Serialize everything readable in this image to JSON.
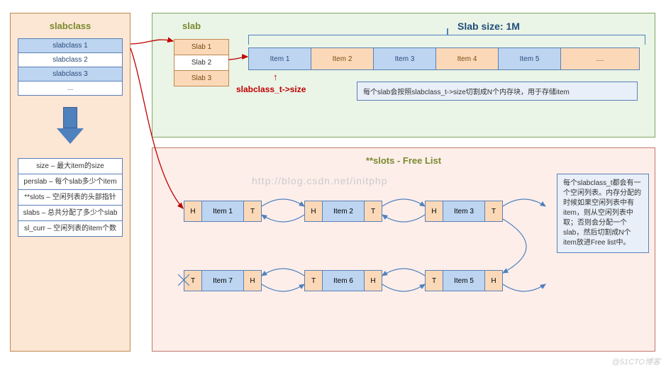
{
  "left": {
    "title": "slabclass",
    "classes": [
      "slabclass 1",
      "slabclass 2",
      "slabclass 3",
      "..."
    ],
    "fields": [
      "size – 最大item的size",
      "perslab – 每个slab多少个item",
      "**slots – 空闲列表的头部指针",
      "slabs – 总共分配了多少个slab",
      "sl_curr – 空闲列表的item个数"
    ]
  },
  "top": {
    "title": "slab",
    "size_title": "Slab size: 1M",
    "slabs": [
      "Slab 1",
      "Slab 2",
      "Slab 3"
    ],
    "items": [
      "Item 1",
      "Item 2",
      "Item 3",
      "Item 4",
      "Item 5",
      "...."
    ],
    "red_ptr": "↑",
    "red_label": "slabclass_t->size",
    "note": "每个slab会按照slabclass_t->size切割成N个内存块，用于存储item"
  },
  "bot": {
    "title": "**slots - Free List",
    "watermark": "http://blog.csdn.net/initphp",
    "row1": [
      {
        "h": "H",
        "m": "Item 1",
        "t": "T"
      },
      {
        "h": "H",
        "m": "Item 2",
        "t": "T"
      },
      {
        "h": "H",
        "m": "Item 3",
        "t": "T"
      }
    ],
    "row2": [
      {
        "h": "T",
        "m": "Item 7",
        "t": "H"
      },
      {
        "h": "T",
        "m": "Item 6",
        "t": "H"
      },
      {
        "h": "T",
        "m": "Item 5",
        "t": "H"
      }
    ],
    "note": "每个slabclass_t都会有一个空闲列表。内存分配的时候如果空闲列表中有item，则从空闲列表中取；否则会分配一个slab，然后切割成N个item放进Free list中。"
  },
  "footer": "@51CTO博客"
}
